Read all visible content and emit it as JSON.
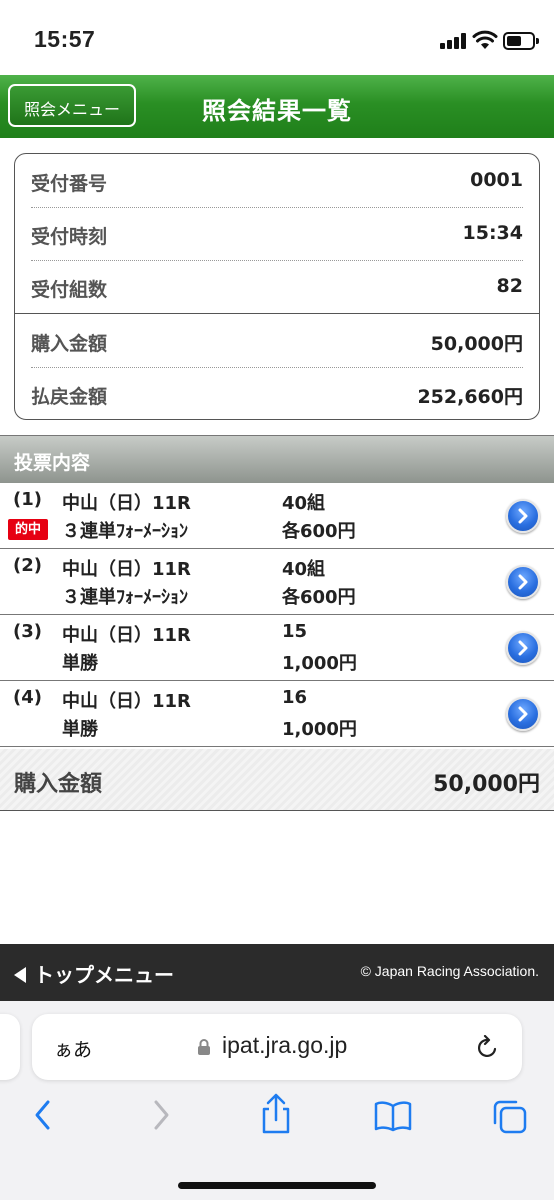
{
  "status_bar": {
    "time": "15:57"
  },
  "header": {
    "back_label": "照会メニュー",
    "title": "照会結果一覧"
  },
  "summary": {
    "rows": [
      {
        "label": "受付番号",
        "value": "0001"
      },
      {
        "label": "受付時刻",
        "value": "15:34"
      },
      {
        "label": "受付組数",
        "value": "82"
      },
      {
        "label": "購入金額",
        "value": "50,000円"
      },
      {
        "label": "払戻金額",
        "value": "252,660円"
      }
    ]
  },
  "section": {
    "title": "投票内容"
  },
  "bets": [
    {
      "num": "(1)",
      "race": "中山（日）11R",
      "type": "３連単ﾌｫｰﾒｰｼｮﾝ",
      "combo": "40組",
      "amount": "各600円",
      "badge": "的中"
    },
    {
      "num": "(2)",
      "race": "中山（日）11R",
      "type": "３連単ﾌｫｰﾒｰｼｮﾝ",
      "combo": "40組",
      "amount": "各600円"
    },
    {
      "num": "(3)",
      "race": "中山（日）11R",
      "type": "単勝",
      "combo": "15",
      "amount": "1,000円"
    },
    {
      "num": "(4)",
      "race": "中山（日）11R",
      "type": "単勝",
      "combo": "16",
      "amount": "1,000円"
    }
  ],
  "total": {
    "label": "購入金額",
    "value": "50,000円"
  },
  "footer": {
    "link": "トップメニュー",
    "copyright": "© Japan Racing Association."
  },
  "browser": {
    "aa": "ぁあ",
    "url": "ipat.jra.go.jp"
  },
  "colors": {
    "header_green": "#2a8f24",
    "hit_red": "#e60012",
    "arrow_blue": "#2a6fe0",
    "footer_dark": "#2b2b2b",
    "safari_blue": "#1e7cf0"
  },
  "icons": [
    "signal-icon",
    "wifi-icon",
    "battery-icon",
    "chevron-right-icon",
    "lock-icon",
    "reload-icon",
    "back-chevron-icon",
    "forward-chevron-icon",
    "share-icon",
    "bookmarks-icon",
    "tabs-icon"
  ]
}
